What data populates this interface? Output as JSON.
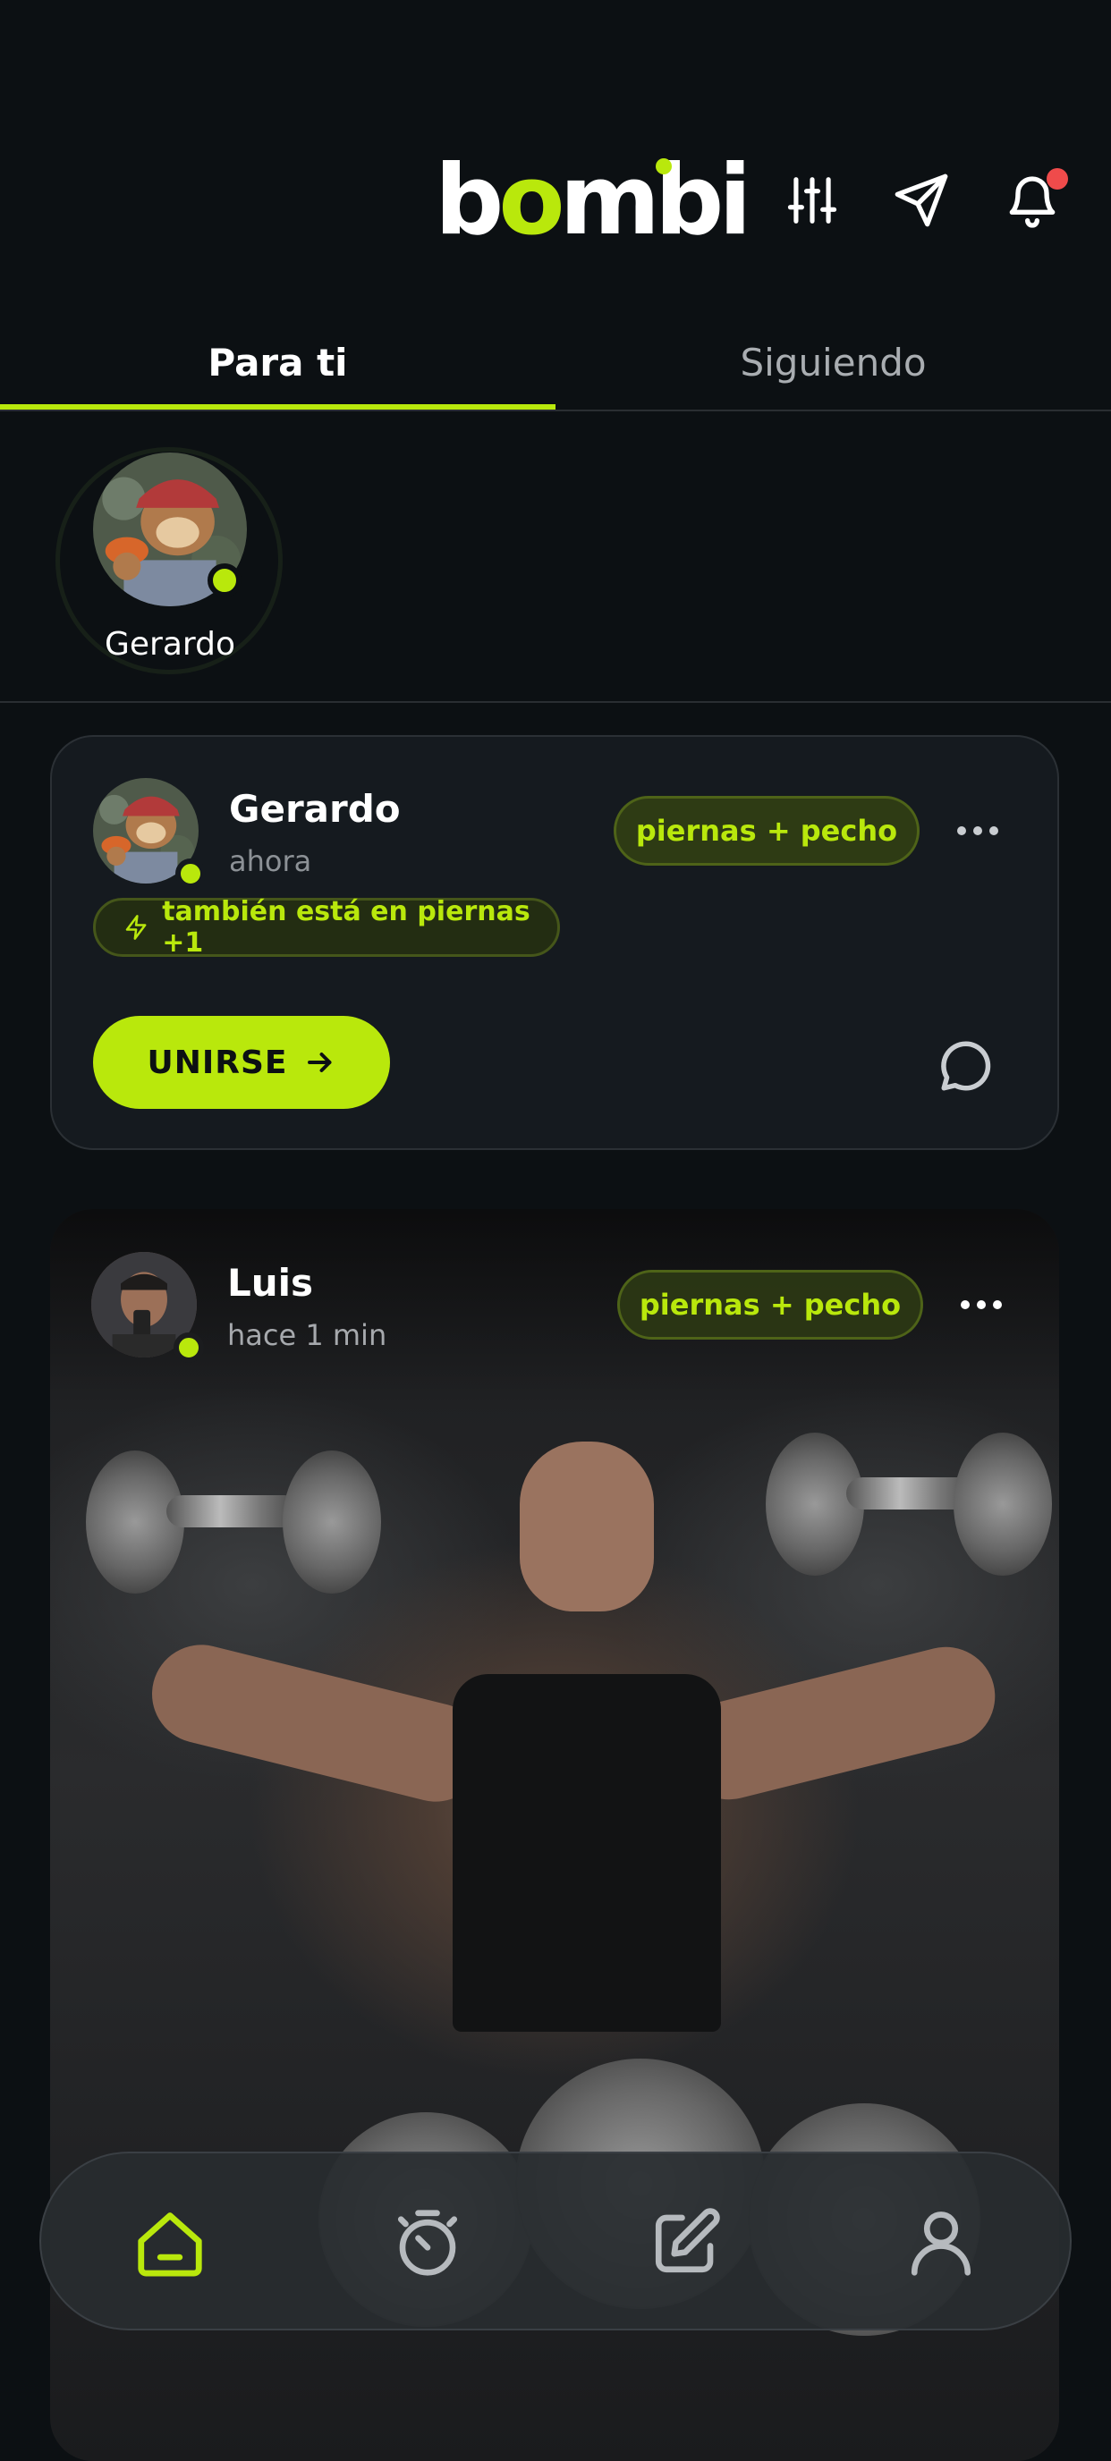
{
  "app": {
    "logo_text_a": "b",
    "logo_text_b": "o",
    "logo_text_c": "mbi"
  },
  "header": {
    "icons": [
      "filter-sliders-icon",
      "send-icon",
      "bell-icon"
    ],
    "has_notification": true
  },
  "tabs": [
    {
      "label": "Para ti",
      "active": true
    },
    {
      "label": "Siguiendo",
      "active": false
    }
  ],
  "stories": [
    {
      "name": "Gerardo",
      "online": true
    }
  ],
  "posts": [
    {
      "user": "Gerardo",
      "time": "ahora",
      "tag": "piernas + pecho",
      "badge": "también está en piernas +1",
      "join_label": "UNIRSE",
      "online": true
    },
    {
      "user": "Luis",
      "time": "hace 1 min",
      "tag": "piernas + pecho",
      "online": true
    }
  ],
  "bottom_nav": [
    {
      "icon": "home-icon",
      "active": true
    },
    {
      "icon": "timer-icon",
      "active": false
    },
    {
      "icon": "edit-icon",
      "active": false
    },
    {
      "icon": "profile-icon",
      "active": false
    }
  ],
  "colors": {
    "accent": "#b9e80c",
    "background": "#0c1013",
    "card": "#151a1f",
    "notification": "#ef4b4b"
  }
}
